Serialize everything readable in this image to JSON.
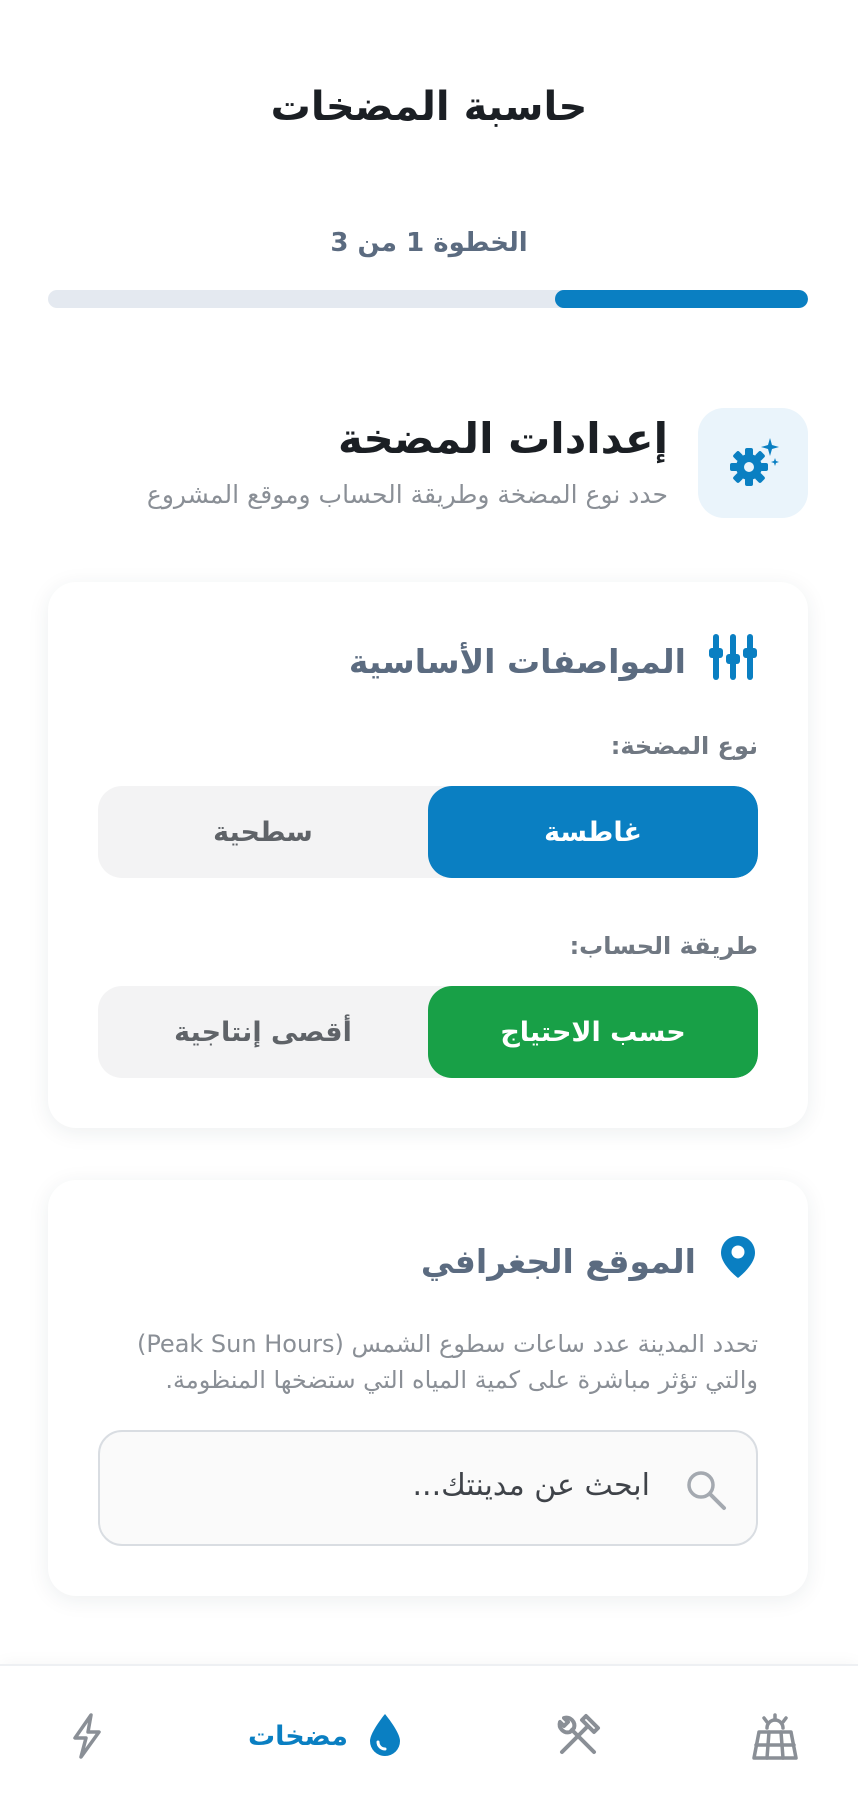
{
  "header": {
    "title": "حاسبة المضخات",
    "step_text": "الخطوة 1 من 3",
    "progress_fraction": 0.333
  },
  "section": {
    "title": "إعدادات المضخة",
    "subtitle": "حدد نوع المضخة وطريقة الحساب وموقع المشروع",
    "icon": "gear-sparkle-icon"
  },
  "specs": {
    "title": "المواصفات الأساسية",
    "icon": "sliders-icon",
    "pump_type": {
      "label": "نوع المضخة:",
      "options": [
        "غاطسة",
        "سطحية"
      ],
      "selected": "غاطسة"
    },
    "calc_method": {
      "label": "طريقة الحساب:",
      "options": [
        "حسب الاحتياج",
        "أقصى إنتاجية"
      ],
      "selected": "حسب الاحتياج"
    }
  },
  "location": {
    "title": "الموقع الجغرافي",
    "icon": "map-pin-icon",
    "description_line1": "تحدد المدينة عدد ساعات سطوع الشمس (Peak Sun Hours)",
    "description_line2": "والتي تؤثر مباشرة على كمية المياه التي ستضخها المنظومة.",
    "search_placeholder": "ابحث عن مدينتك..."
  },
  "bottom_nav": {
    "items": [
      {
        "icon": "solar-panel-icon",
        "label": ""
      },
      {
        "icon": "tools-icon",
        "label": ""
      },
      {
        "icon": "water-drop-icon",
        "label": "مضخات",
        "active": true
      },
      {
        "icon": "lightning-icon",
        "label": ""
      }
    ]
  },
  "colors": {
    "primary": "#0a7fc2",
    "success": "#18a047",
    "muted_title": "#5b6b80",
    "track": "#e4e9f0"
  }
}
